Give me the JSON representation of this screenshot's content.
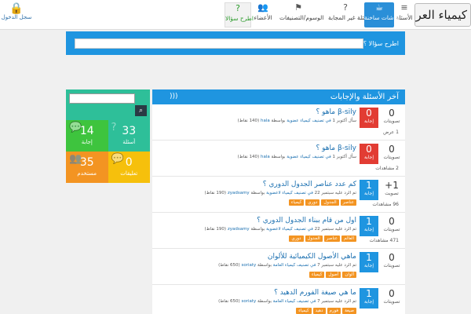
{
  "brand": "كيمياء العرب",
  "nav": [
    {
      "id": "questions",
      "label": "الأسئلة",
      "icon": "≡"
    },
    {
      "id": "unanswered",
      "label": "الأسئلة غير المجابة",
      "icon": "?"
    },
    {
      "id": "hot",
      "label": "نقاشات ساخنة",
      "icon": "☕"
    },
    {
      "id": "tags",
      "label": "الوسوم/التصنيفات",
      "icon": "⚑"
    },
    {
      "id": "users",
      "label": "الأعضاء",
      "icon": "👥"
    },
    {
      "id": "ask",
      "label": "اطرح سؤالا",
      "icon": "?"
    }
  ],
  "login": {
    "label": "سجل الدخول",
    "icon": "🔒"
  },
  "askbar": {
    "label": "اطرح سؤالا ؟",
    "placeholder": ""
  },
  "sidebar": {
    "search_placeholder": "",
    "stats": [
      {
        "num": "14",
        "label": "إجابة",
        "color": "green",
        "icon": "💬"
      },
      {
        "num": "33",
        "label": "أسئلة",
        "color": "teal",
        "icon": "?"
      },
      {
        "num": "35",
        "label": "مستخدم",
        "color": "orange",
        "icon": "👥"
      },
      {
        "num": "0",
        "label": "تعليقات",
        "color": "yellow",
        "icon": "💬"
      }
    ]
  },
  "main": {
    "title": "آخر الأسئلة والإجابات",
    "questions": [
      {
        "title": "β-sily ماهو ؟",
        "votes": "0",
        "votes_label": "تصويتات",
        "answers": "0",
        "answers_label": "إجابة",
        "answers_color": "red",
        "meta_prefix": "سأل",
        "time": "أكتوبر 1",
        "category": "في تصنيف كيمياء عضوية",
        "by": "بواسطة",
        "user": "hala",
        "points": "(140 نقاط)",
        "views": "1 عرض",
        "tags": []
      },
      {
        "title": "β-sily ماهو ؟",
        "votes": "0",
        "votes_label": "تصويتات",
        "answers": "0",
        "answers_label": "إجابة",
        "answers_color": "red",
        "meta_prefix": "سأل",
        "time": "أكتوبر 1",
        "category": "في تصنيف كيمياء عضوية",
        "by": "بواسطة",
        "user": "hala",
        "points": "(140 نقاط)",
        "views": "2 مشاهدات",
        "tags": []
      },
      {
        "title": "كم عدد عناصر الجدول الدوري ؟",
        "votes": "+1",
        "votes_label": "تصويت",
        "answers": "1",
        "answers_label": "إجابة",
        "answers_color": "blue",
        "meta_prefix": "تم الرد عليه",
        "time": "سبتمبر 22",
        "category": "في تصنيف كيمياء لاعضوية",
        "by": "بواسطة",
        "user": "zyadsamy",
        "points": "(190 نقاط)",
        "views": "96 مشاهدات",
        "tags": [
          "عناصر",
          "الجدول",
          "دوري",
          "كيمياء"
        ]
      },
      {
        "title": "اول من قام ببناء الجدول الدوري ؟",
        "votes": "0",
        "votes_label": "تصويتات",
        "answers": "1",
        "answers_label": "إجابة",
        "answers_color": "blue",
        "meta_prefix": "تم الرد عليه",
        "time": "سبتمبر 22",
        "category": "في تصنيف كيمياء لاعضوية",
        "by": "بواسطة",
        "user": "zyadsamy",
        "points": "(190 نقاط)",
        "views": "471 مشاهدات",
        "tags": [
          "العالم",
          "عناصر",
          "الجدول",
          "دوري"
        ]
      },
      {
        "title": "ماهي الأصول الكيميائية للألوان",
        "votes": "0",
        "votes_label": "تصويتات",
        "answers": "1",
        "answers_label": "إجابة",
        "answers_color": "blue",
        "meta_prefix": "تم الرد عليه",
        "time": "سبتمبر 7",
        "category": "في تصنيف كيمياء العامة",
        "by": "بواسطة",
        "user": "soriaty",
        "points": "(650 نقاط)",
        "views": "",
        "tags": [
          "ألوان",
          "أصول",
          "كيمياء"
        ]
      },
      {
        "title": "ما هي صيغة الفورم الدهيد ؟",
        "votes": "0",
        "votes_label": "تصويتات",
        "answers": "1",
        "answers_label": "إجابة",
        "answers_color": "blue",
        "meta_prefix": "تم الرد عليه",
        "time": "سبتمبر 7",
        "category": "في تصنيف كيمياء العامة",
        "by": "بواسطة",
        "user": "soriaty",
        "points": "(650 نقاط)",
        "views": "",
        "tags": [
          "صيغة",
          "فورم",
          "دهيد",
          "كيمياء"
        ]
      }
    ]
  }
}
